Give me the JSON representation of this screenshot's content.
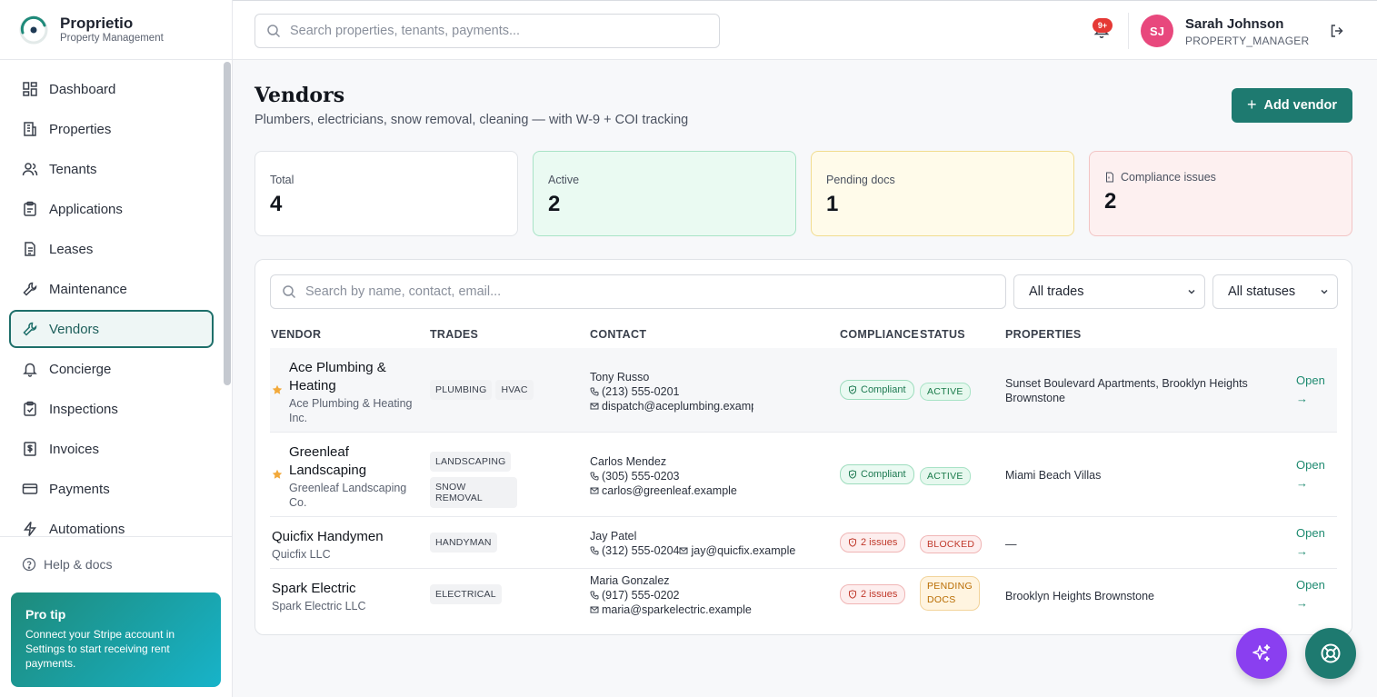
{
  "brand": {
    "name": "Proprietio",
    "subtitle": "Property Management"
  },
  "nav": {
    "items": [
      {
        "label": "Dashboard",
        "icon": "dashboard-icon"
      },
      {
        "label": "Properties",
        "icon": "building-icon"
      },
      {
        "label": "Tenants",
        "icon": "users-icon"
      },
      {
        "label": "Applications",
        "icon": "clipboard-icon"
      },
      {
        "label": "Leases",
        "icon": "document-icon"
      },
      {
        "label": "Maintenance",
        "icon": "wrench-icon"
      },
      {
        "label": "Vendors",
        "icon": "wrench-icon",
        "active": true
      },
      {
        "label": "Concierge",
        "icon": "bell-icon"
      },
      {
        "label": "Inspections",
        "icon": "clipboard-check-icon"
      },
      {
        "label": "Invoices",
        "icon": "invoice-icon"
      },
      {
        "label": "Payments",
        "icon": "credit-card-icon"
      },
      {
        "label": "Automations",
        "icon": "lightning-icon"
      }
    ],
    "help_label": "Help & docs"
  },
  "protip": {
    "title": "Pro tip",
    "text": "Connect your Stripe account in Settings to start receiving rent payments."
  },
  "header": {
    "search_placeholder": "Search properties, tenants, payments...",
    "notification_badge": "9+",
    "user": {
      "initials": "SJ",
      "name": "Sarah Johnson",
      "role": "PROPERTY_MANAGER"
    }
  },
  "page": {
    "title": "Vendors",
    "subtitle": "Plumbers, electricians, snow removal, cleaning — with W-9 + COI tracking",
    "add_button": "Add vendor"
  },
  "stats": [
    {
      "label": "Total",
      "value": "4"
    },
    {
      "label": "Active",
      "value": "2"
    },
    {
      "label": "Pending docs",
      "value": "1"
    },
    {
      "label": "Compliance issues",
      "value": "2"
    }
  ],
  "filters": {
    "search_placeholder": "Search by name, contact, email...",
    "trade_selected": "All trades",
    "status_selected": "All statuses"
  },
  "table": {
    "columns": [
      "VENDOR",
      "TRADES",
      "CONTACT",
      "COMPLIANCE",
      "STATUS",
      "PROPERTIES"
    ],
    "rows": [
      {
        "name": "Ace Plumbing & Heating",
        "legal": "Ace Plumbing & Heating Inc.",
        "starred": true,
        "trades": [
          "PLUMBING",
          "HVAC"
        ],
        "contact_name": "Tony Russo",
        "phone": "(213) 555-0201",
        "email": "dispatch@aceplumbing.example",
        "compliance": "Compliant",
        "status": "ACTIVE",
        "properties": "Sunset Boulevard Apartments, Brooklyn Heights Brownstone",
        "action": "Open →"
      },
      {
        "name": "Greenleaf Landscaping",
        "legal": "Greenleaf Landscaping Co.",
        "starred": true,
        "trades": [
          "LANDSCAPING",
          "SNOW REMOVAL"
        ],
        "contact_name": "Carlos Mendez",
        "phone": "(305) 555-0203",
        "email": "carlos@greenleaf.example",
        "compliance": "Compliant",
        "status": "ACTIVE",
        "properties": "Miami Beach Villas",
        "action": "Open →"
      },
      {
        "name": "Quicfix Handymen",
        "legal": "Quicfix LLC",
        "starred": false,
        "trades": [
          "HANDYMAN"
        ],
        "contact_name": "Jay Patel",
        "phone": "(312) 555-0204",
        "email": "jay@quicfix.example",
        "compliance": "2 issues",
        "status": "BLOCKED",
        "properties": "—",
        "action": "Open →"
      },
      {
        "name": "Spark Electric",
        "legal": "Spark Electric LLC",
        "starred": false,
        "trades": [
          "ELECTRICAL"
        ],
        "contact_name": "Maria Gonzalez",
        "phone": "(917) 555-0202",
        "email": "maria@sparkelectric.example",
        "compliance": "2 issues",
        "status": "PENDING DOCS",
        "properties": "Brooklyn Heights Brownstone",
        "action": "Open →"
      }
    ]
  },
  "colors": {
    "accent": "#1e7a70",
    "ai_fab": "#8a3ff0",
    "avatar": "#e8487d"
  }
}
